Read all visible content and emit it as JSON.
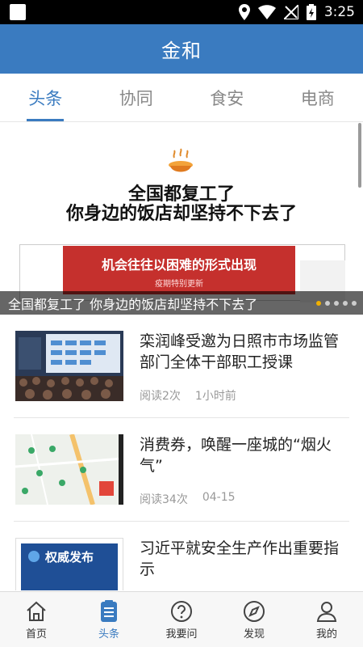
{
  "status_bar": {
    "time": "3:25"
  },
  "app": {
    "title": "金和"
  },
  "tabs": [
    {
      "label": "头条",
      "active": true
    },
    {
      "label": "协同",
      "active": false
    },
    {
      "label": "食安",
      "active": false
    },
    {
      "label": "电商",
      "active": false
    }
  ],
  "banner": {
    "headline_line1": "全国都复工了",
    "headline_line2": "你身边的饭店却坚持不下去了",
    "inner_main": "机会往往以困难的形式出现",
    "inner_sub": "疫期特别更新",
    "caption": "全国都复工了 你身边的饭店却坚持不下去了"
  },
  "news": [
    {
      "title": "栾润峰受邀为日照市市场监管部门全体干部职工授课",
      "reads": "阅读2次",
      "time": "1小时前"
    },
    {
      "title": "消费券，唤醒一座城的“烟火气”",
      "reads": "阅读34次",
      "time": "04-15"
    },
    {
      "title": "习近平就安全生产作出重要指示",
      "thumb_text": "权威发布"
    }
  ],
  "bottom_nav": [
    {
      "label": "首页",
      "icon": "home-icon",
      "active": false
    },
    {
      "label": "头条",
      "icon": "document-icon",
      "active": true
    },
    {
      "label": "我要问",
      "icon": "question-icon",
      "active": false
    },
    {
      "label": "发现",
      "icon": "compass-icon",
      "active": false
    },
    {
      "label": "我的",
      "icon": "person-icon",
      "active": false
    }
  ],
  "colors": {
    "primary": "#3a7bc0",
    "banner_red": "#c5302d",
    "indicator": "#f0b000"
  }
}
